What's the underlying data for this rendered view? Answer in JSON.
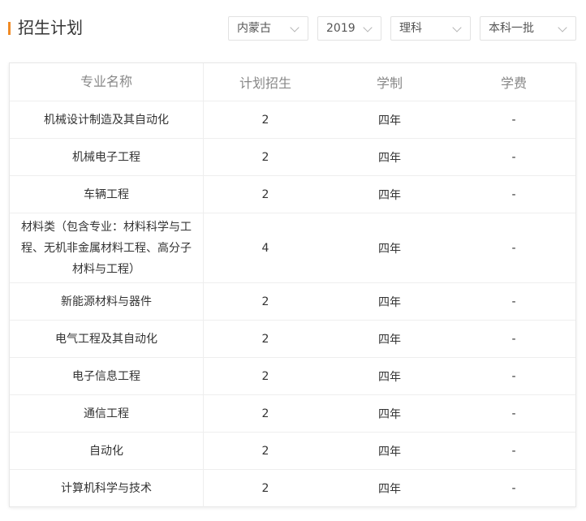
{
  "header": {
    "title": "招生计划"
  },
  "filters": {
    "province": "内蒙古",
    "year": "2019",
    "subject": "理科",
    "batch": "本科一批"
  },
  "table": {
    "columns": [
      "专业名称",
      "计划招生",
      "学制",
      "学费"
    ],
    "rows": [
      {
        "major": "机械设计制造及其自动化",
        "plan": "2",
        "duration": "四年",
        "fee": "-"
      },
      {
        "major": "机械电子工程",
        "plan": "2",
        "duration": "四年",
        "fee": "-"
      },
      {
        "major": "车辆工程",
        "plan": "2",
        "duration": "四年",
        "fee": "-"
      },
      {
        "major": "材料类（包含专业：材料科学与工程、无机非金属材料工程、高分子材料与工程）",
        "plan": "4",
        "duration": "四年",
        "fee": "-"
      },
      {
        "major": "新能源材料与器件",
        "plan": "2",
        "duration": "四年",
        "fee": "-"
      },
      {
        "major": "电气工程及其自动化",
        "plan": "2",
        "duration": "四年",
        "fee": "-"
      },
      {
        "major": "电子信息工程",
        "plan": "2",
        "duration": "四年",
        "fee": "-"
      },
      {
        "major": "通信工程",
        "plan": "2",
        "duration": "四年",
        "fee": "-"
      },
      {
        "major": "自动化",
        "plan": "2",
        "duration": "四年",
        "fee": "-"
      },
      {
        "major": "计算机科学与技术",
        "plan": "2",
        "duration": "四年",
        "fee": "-"
      }
    ]
  },
  "colors": {
    "accent": "#f08a24",
    "border": "#eeeeee",
    "header_text": "#888888"
  }
}
